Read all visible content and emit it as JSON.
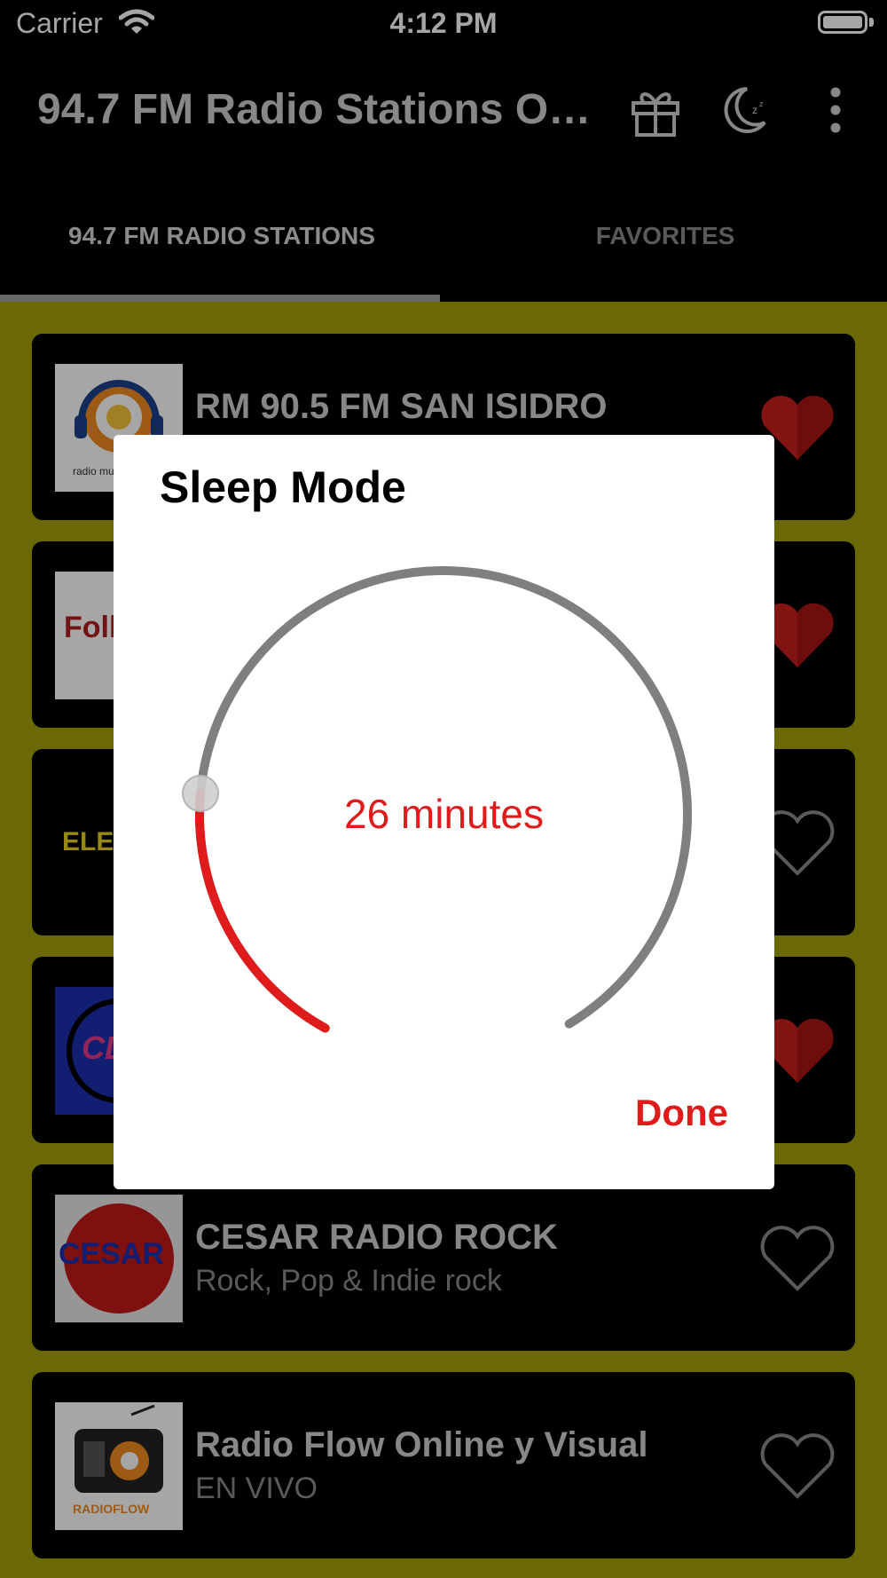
{
  "status_bar": {
    "carrier": "Carrier",
    "time": "4:12 PM"
  },
  "app_bar": {
    "title": "94.7 FM Radio Stations Online",
    "icons": [
      "gift-icon",
      "moon-sleep-icon",
      "more-vertical-icon"
    ]
  },
  "tabs": [
    {
      "label": "94.7 FM RADIO STATIONS",
      "active": true
    },
    {
      "label": "FAVORITES",
      "active": false
    }
  ],
  "stations": [
    {
      "title": "RM 90.5 FM SAN ISIDRO",
      "subtitle": "",
      "favorite": true,
      "logo_text": "radio mu"
    },
    {
      "title": "",
      "subtitle": "",
      "favorite": true,
      "logo_text": "Folk"
    },
    {
      "title": "",
      "subtitle": "",
      "favorite": false,
      "logo_text": "ELE"
    },
    {
      "title": "",
      "subtitle": "",
      "favorite": true,
      "logo_text": "CLA"
    },
    {
      "title": "CESAR RADIO ROCK",
      "subtitle": "Rock, Pop & Indie rock",
      "favorite": false,
      "logo_text": "CESAR"
    },
    {
      "title": "Radio Flow Online y Visual",
      "subtitle": "EN VIVO",
      "favorite": false,
      "logo_text": "RADIOFLOW"
    }
  ],
  "dialog": {
    "title": "Sleep Mode",
    "minutes_label": "26 minutes",
    "value_fraction": 0.22,
    "done_label": "Done",
    "colors": {
      "accent": "#e01b1b",
      "track": "#7f7f7f"
    }
  }
}
